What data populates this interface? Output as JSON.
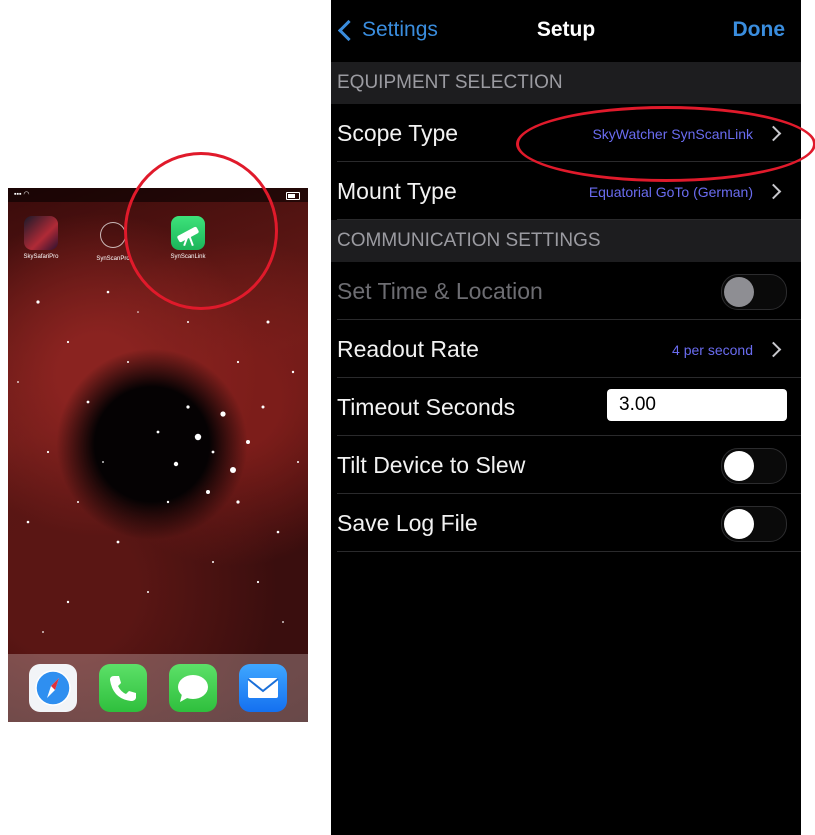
{
  "phone": {
    "apps": [
      {
        "label": "SkySafariPro",
        "icon": "skysafari-icon"
      },
      {
        "label": "SynScanPro",
        "icon": "camera-icon"
      },
      {
        "label": "SynScanLink",
        "icon": "telescope-icon"
      }
    ],
    "dock": [
      {
        "icon": "safari-icon"
      },
      {
        "icon": "phone-icon"
      },
      {
        "icon": "messages-icon"
      },
      {
        "icon": "mail-icon"
      }
    ]
  },
  "settings": {
    "nav": {
      "back_label": "Settings",
      "title": "Setup",
      "done_label": "Done"
    },
    "sections": {
      "equipment": "EQUIPMENT SELECTION",
      "communication": "COMMUNICATION SETTINGS"
    },
    "scope_type": {
      "label": "Scope Type",
      "value": "SkyWatcher SynScanLink"
    },
    "mount_type": {
      "label": "Mount Type",
      "value": "Equatorial GoTo (German)"
    },
    "set_time_location": {
      "label": "Set Time & Location",
      "on": false,
      "enabled": false
    },
    "readout_rate": {
      "label": "Readout Rate",
      "value": "4 per second"
    },
    "timeout_seconds": {
      "label": "Timeout Seconds",
      "value": "3.00"
    },
    "tilt_device": {
      "label": "Tilt Device to Slew",
      "on": false
    },
    "save_log": {
      "label": "Save Log File",
      "on": false
    }
  },
  "colors": {
    "accent": "#3a8dde",
    "value_text": "#6a6cf0",
    "highlight": "#e01a2b",
    "section_bg": "#1d1d1f"
  }
}
